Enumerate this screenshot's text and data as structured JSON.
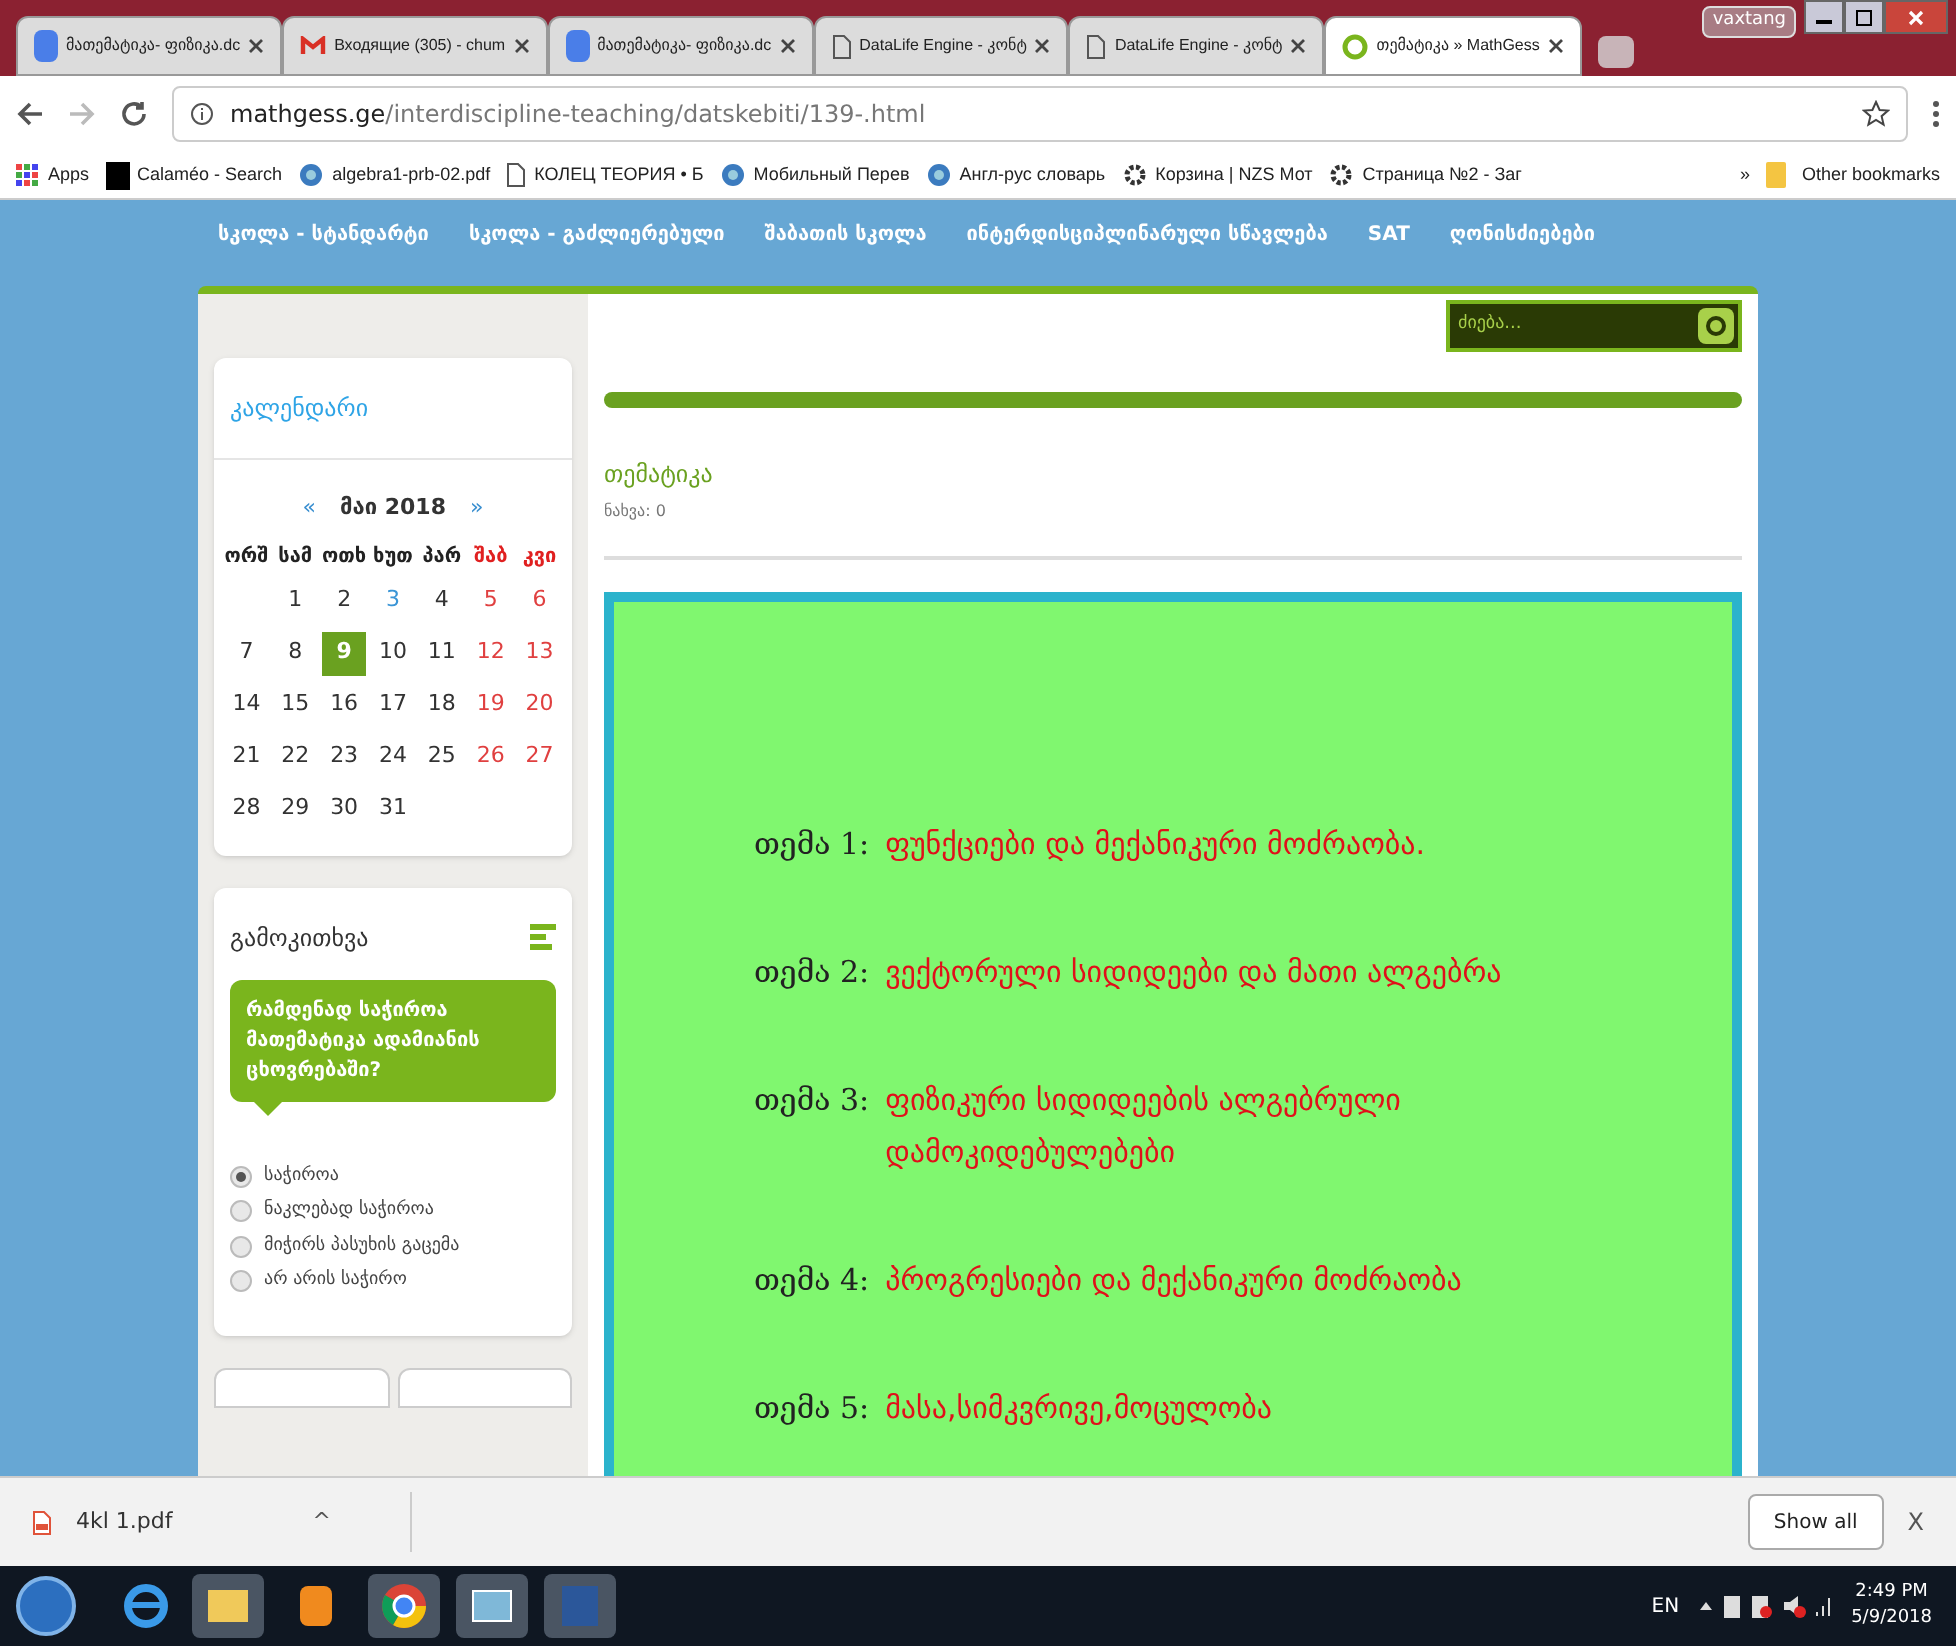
{
  "browser": {
    "tabs": [
      {
        "title": "მათემატიკა- ფიზიკა.dc",
        "kind": "doc",
        "selected": false
      },
      {
        "title": "Входящие (305) - chum",
        "kind": "mail",
        "selected": false
      },
      {
        "title": "მათემატიკა- ფიზიკა.dc",
        "kind": "doc",
        "selected": false
      },
      {
        "title": "DataLife Engine - კონტ",
        "kind": "page",
        "selected": false
      },
      {
        "title": "DataLife Engine - კონტ",
        "kind": "page",
        "selected": false
      },
      {
        "title": "თემატიკა » MathGess",
        "kind": "site",
        "selected": true
      }
    ],
    "user": "vaxtang",
    "url_host": "mathgess.ge",
    "url_path": "/interdiscipline-teaching/datskebiti/139-.html",
    "bookmarks": [
      {
        "label": "Apps",
        "kind": "apps"
      },
      {
        "label": "Calaméo - Search",
        "kind": "letter"
      },
      {
        "label": "algebra1-prb-02.pdf",
        "kind": "globe"
      },
      {
        "label": "КОЛЕЦ ТЕОРИЯ • Б",
        "kind": "page"
      },
      {
        "label": "Мобильный Перев",
        "kind": "globe"
      },
      {
        "label": "Англ-рус словарь",
        "kind": "globe"
      },
      {
        "label": "Корзина | NZS Мот",
        "kind": "gear"
      },
      {
        "label": "Страница №2 - Заг",
        "kind": "gear"
      }
    ],
    "more": "»",
    "other": "Other bookmarks"
  },
  "nav": [
    "სკოლა - სტანდარტი",
    "სკოლა - გაძლიერებული",
    "შაბათის სკოლა",
    "ინტერდისციპლინარული სწავლება",
    "SAT",
    "ღონისძიებები"
  ],
  "search": {
    "placeholder": "ძიება..."
  },
  "calendar": {
    "title": "კალენდარი",
    "prev": "«",
    "month": "მაი 2018",
    "next": "»",
    "weekdays": [
      "ორშ",
      "სამ",
      "ოთხ",
      "ხუთ",
      "პარ",
      "შაბ",
      "კვი"
    ],
    "weeks": [
      [
        {
          "day": "1",
          "selected": false,
          "link": false
        },
        {
          "day": "2",
          "selected": false,
          "link": false
        },
        {
          "day": "3",
          "selected": false,
          "link": true
        },
        {
          "day": "4",
          "selected": false,
          "link": false
        },
        {
          "day": "5",
          "selected": false,
          "link": false
        },
        {
          "day": "6",
          "selected": false,
          "link": false
        }
      ],
      [
        {
          "day": "7",
          "selected": false,
          "link": false
        },
        {
          "day": "8",
          "selected": false,
          "link": false
        },
        {
          "day": "9",
          "selected": true,
          "link": false
        },
        {
          "day": "10",
          "selected": false,
          "link": false
        },
        {
          "day": "11",
          "selected": false,
          "link": false
        },
        {
          "day": "12",
          "selected": false,
          "link": false
        },
        {
          "day": "13",
          "selected": false,
          "link": false
        }
      ],
      [
        {
          "day": "14",
          "selected": false,
          "link": false
        },
        {
          "day": "15",
          "selected": false,
          "link": false
        },
        {
          "day": "16",
          "selected": false,
          "link": false
        },
        {
          "day": "17",
          "selected": false,
          "link": false
        },
        {
          "day": "18",
          "selected": false,
          "link": false
        },
        {
          "day": "19",
          "selected": false,
          "link": false
        },
        {
          "day": "20",
          "selected": false,
          "link": false
        }
      ],
      [
        {
          "day": "21",
          "selected": false,
          "link": false
        },
        {
          "day": "22",
          "selected": false,
          "link": false
        },
        {
          "day": "23",
          "selected": false,
          "link": false
        },
        {
          "day": "24",
          "selected": false,
          "link": false
        },
        {
          "day": "25",
          "selected": false,
          "link": false
        },
        {
          "day": "26",
          "selected": false,
          "link": false
        },
        {
          "day": "27",
          "selected": false,
          "link": false
        }
      ],
      [
        {
          "day": "28",
          "selected": false,
          "link": false
        },
        {
          "day": "29",
          "selected": false,
          "link": false
        },
        {
          "day": "30",
          "selected": false,
          "link": false
        },
        {
          "day": "31",
          "selected": false,
          "link": false
        }
      ]
    ]
  },
  "poll": {
    "title": "გამოკითხვა",
    "question": "რამდენად საჭიროა მათემატიკა ადამიანის ცხოვრებაში?",
    "options": [
      {
        "label": "საჭიროა",
        "selected": true
      },
      {
        "label": "ნაკლებად საჭიროა",
        "selected": false
      },
      {
        "label": "მიჭირს პასუხის გაცემა",
        "selected": false
      },
      {
        "label": "არ არის საჭირო",
        "selected": false
      }
    ]
  },
  "article": {
    "title": "თემატიკა",
    "views": "ნახვა: 0",
    "topics": [
      {
        "label": "თემა 1:",
        "text": "ფუნქციები და მექანიკური მოძრაობა."
      },
      {
        "label": "თემა 2:",
        "text": "ვექტორული სიდიდეები და მათი ალგებრა"
      },
      {
        "label": "თემა 3:",
        "text": "ფიზიკური სიდიდეების ალგებრული დამოკიდებულებები"
      },
      {
        "label": "თემა 4:",
        "text": "პროგრესიები და მექანიკური მოძრაობა"
      },
      {
        "label": "თემა 5:",
        "text": "მასა,სიმკვრივე,მოცულობა"
      }
    ]
  },
  "downloads": {
    "file": "4kl 1.pdf",
    "caret": "^",
    "show_all": "Show all",
    "close": "X"
  },
  "taskbar": {
    "lang": "EN",
    "time": "2:49 PM",
    "date": "5/9/2018"
  }
}
